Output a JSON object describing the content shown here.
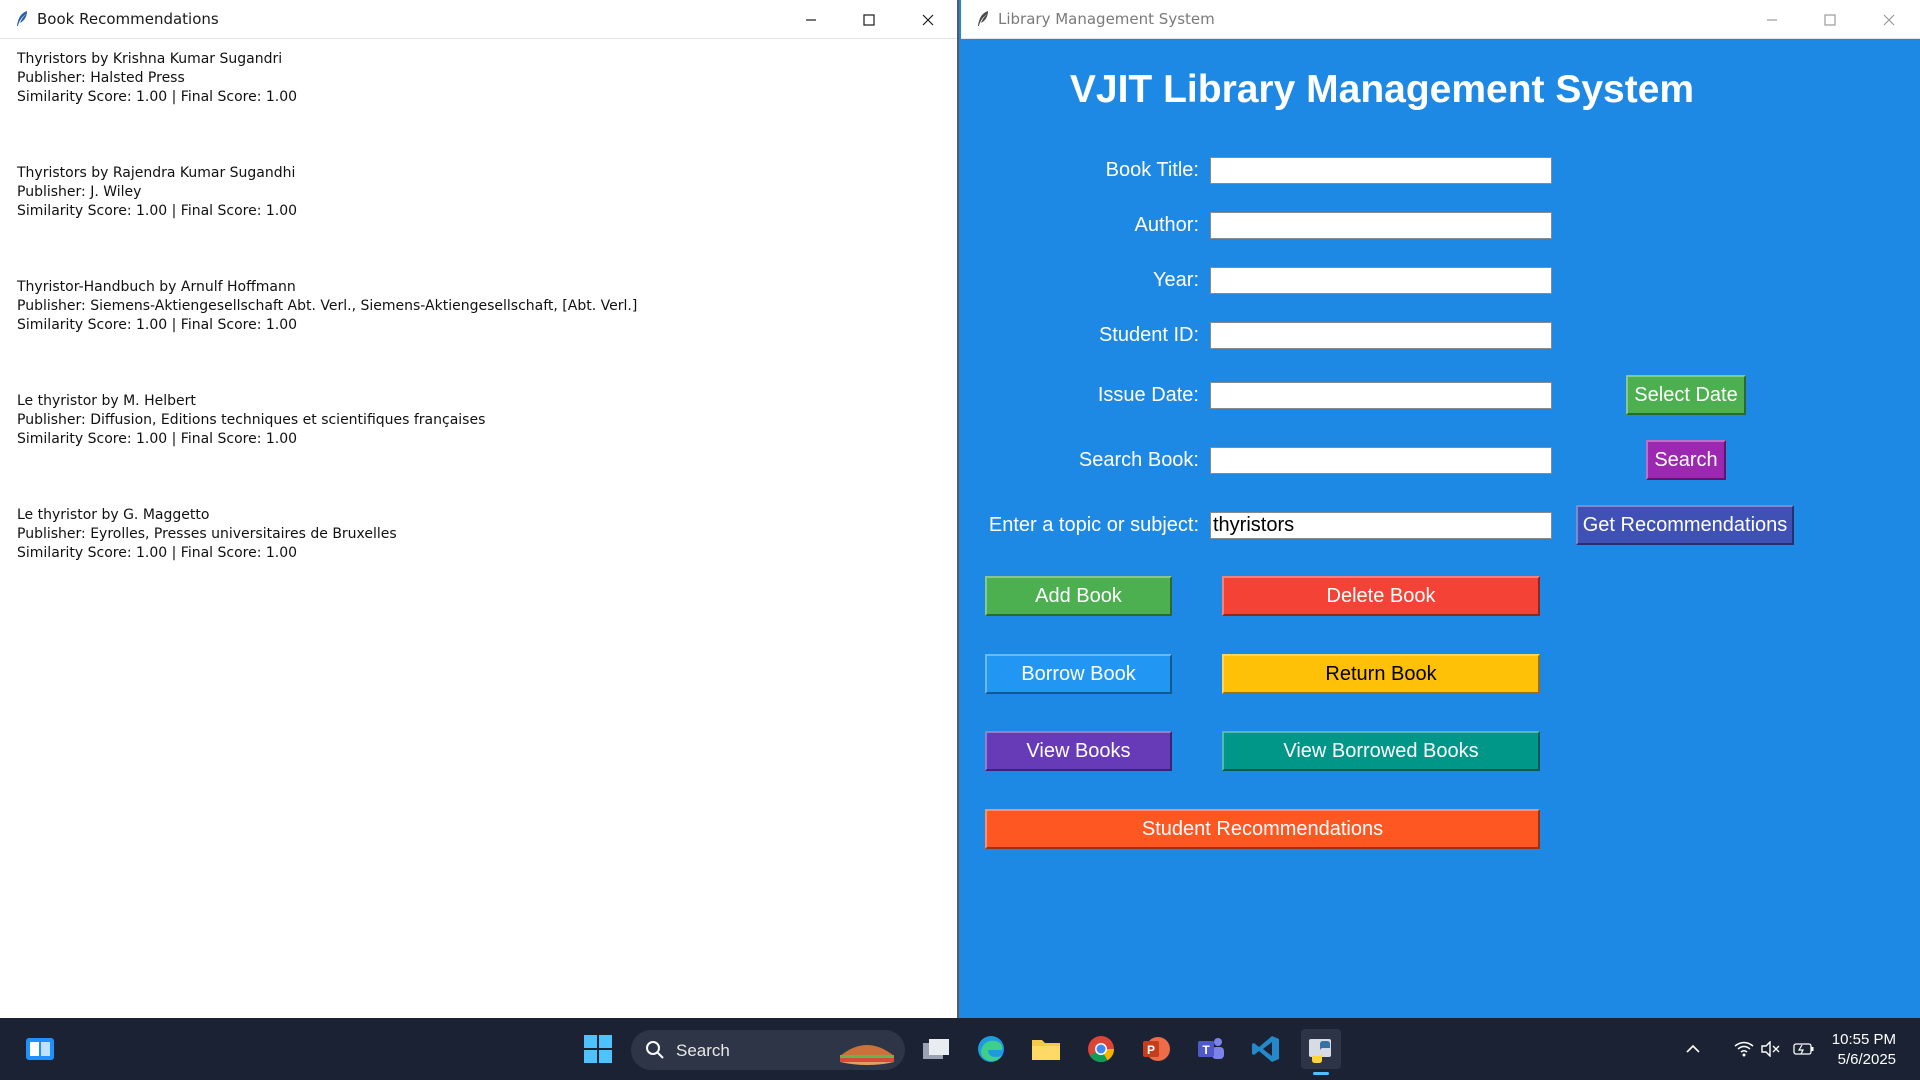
{
  "left_window": {
    "title": "Book Recommendations",
    "recommendations": [
      {
        "line1": "Thyristors by Krishna Kumar Sugandri",
        "line2": "Publisher: Halsted Press",
        "line3": "Similarity Score: 1.00 | Final Score: 1.00"
      },
      {
        "line1": "Thyristors by Rajendra Kumar Sugandhi",
        "line2": "Publisher: J. Wiley",
        "line3": "Similarity Score: 1.00 | Final Score: 1.00"
      },
      {
        "line1": "Thyristor-Handbuch by Arnulf Hoffmann",
        "line2": "Publisher: Siemens-Aktiengesellschaft Abt. Verl., Siemens-Aktiengesellschaft, [Abt. Verl.]",
        "line3": "Similarity Score: 1.00 | Final Score: 1.00"
      },
      {
        "line1": "Le thyristor by M. Helbert",
        "line2": "Publisher: Diffusion, Editions techniques et scientifiques françaises",
        "line3": "Similarity Score: 1.00 | Final Score: 1.00"
      },
      {
        "line1": "Le thyristor by G. Maggetto",
        "line2": "Publisher: Eyrolles, Presses universitaires de Bruxelles",
        "line3": "Similarity Score: 1.00 | Final Score: 1.00"
      }
    ]
  },
  "right_window": {
    "title": "Library Management System",
    "heading": "VJIT Library Management System",
    "fields": {
      "book_title": {
        "label": "Book Title:",
        "value": ""
      },
      "author": {
        "label": "Author:",
        "value": ""
      },
      "year": {
        "label": "Year:",
        "value": ""
      },
      "student_id": {
        "label": "Student ID:",
        "value": ""
      },
      "issue_date": {
        "label": "Issue Date:",
        "value": ""
      },
      "search_book": {
        "label": "Search Book:",
        "value": ""
      },
      "topic": {
        "label": "Enter a topic or subject:",
        "value": "thyristors"
      }
    },
    "buttons": {
      "select_date": "Select Date",
      "search": "Search",
      "get_recommendations": "Get Recommendations",
      "add_book": "Add Book",
      "delete_book": "Delete Book",
      "borrow_book": "Borrow Book",
      "return_book": "Return Book",
      "view_books": "View Books",
      "view_borrowed_books": "View Borrowed Books",
      "student_recommendations": "Student Recommendations"
    },
    "colors": {
      "background": "#1e88e5",
      "green": "#4caf50",
      "red": "#f44336",
      "blue": "#2196f3",
      "amber": "#ffc107",
      "purple": "#673ab7",
      "teal": "#009688",
      "deep_orange": "#ff5722",
      "magenta": "#9c27b0",
      "indigo": "#3f51b5"
    }
  },
  "taskbar": {
    "search_label": "Search",
    "time": "10:55 PM",
    "date": "5/6/2025",
    "apps": [
      "start-icon",
      "file-explorer-icon",
      "edge-icon",
      "folder-icon",
      "chrome-icon",
      "powerpoint-icon",
      "teams-icon",
      "vscode-icon",
      "python-icon"
    ]
  }
}
